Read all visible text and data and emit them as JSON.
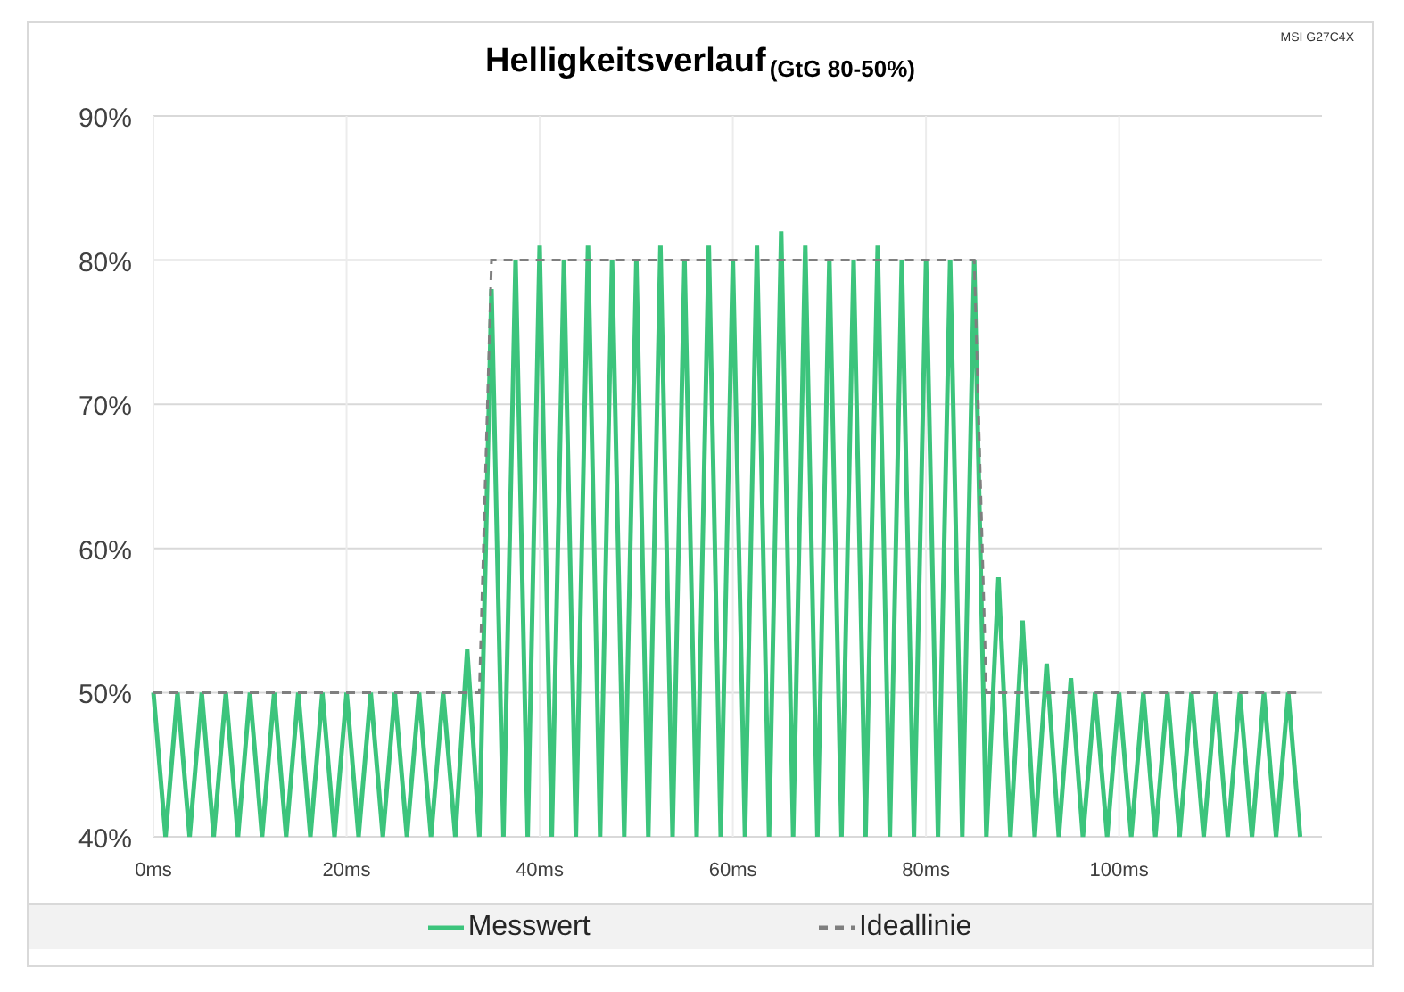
{
  "chart": {
    "subtitle": "(GtG 80-50%)",
    "corner_label": "MSI G27C4X",
    "chart_data": {
      "type": "line",
      "title": "Helligkeitsverlauf",
      "x": [
        0,
        1.25,
        2.5,
        3.75,
        5,
        6.25,
        7.5,
        8.75,
        10,
        11.25,
        12.5,
        13.75,
        15,
        16.25,
        17.5,
        18.75,
        20,
        21.25,
        22.5,
        23.75,
        25,
        26.25,
        27.5,
        28.75,
        30,
        31.25,
        32.5,
        33.75,
        35,
        36.25,
        37.5,
        38.75,
        40,
        41.25,
        42.5,
        43.75,
        45,
        46.25,
        47.5,
        48.75,
        50,
        51.25,
        52.5,
        53.75,
        55,
        56.25,
        57.5,
        58.75,
        60,
        61.25,
        62.5,
        63.75,
        65,
        66.25,
        67.5,
        68.75,
        70,
        71.25,
        72.5,
        73.75,
        75,
        76.25,
        77.5,
        78.75,
        80,
        81.25,
        82.5,
        83.75,
        85,
        86.25,
        87.5,
        88.75,
        90,
        91.25,
        92.5,
        93.75,
        95,
        96.25,
        97.5,
        98.75,
        100,
        101.25,
        102.5,
        103.75,
        105,
        106.25,
        107.5,
        108.75,
        110,
        111.25,
        112.5,
        113.75,
        115,
        116.25,
        117.5,
        118.75
      ],
      "series": [
        {
          "name": "Messwert",
          "color": "#3cc47c",
          "line_style": "solid",
          "values": [
            50,
            40,
            50,
            40,
            50,
            40,
            50,
            40,
            50,
            40,
            50,
            40,
            50,
            40,
            50,
            40,
            50,
            40,
            50,
            40,
            50,
            40,
            50,
            40,
            50,
            40,
            53,
            40,
            78,
            40,
            80,
            40,
            81,
            40,
            80,
            40,
            81,
            40,
            80,
            40,
            80,
            40,
            81,
            40,
            80,
            40,
            81,
            40,
            80,
            40,
            81,
            40,
            82,
            40,
            81,
            40,
            80,
            40,
            80,
            40,
            81,
            40,
            80,
            40,
            80,
            40,
            80,
            40,
            80,
            40,
            58,
            40,
            55,
            40,
            52,
            40,
            51,
            40,
            50,
            40,
            50,
            40,
            50,
            40,
            50,
            40,
            50,
            40,
            50,
            40,
            50,
            40,
            50,
            40,
            50,
            40
          ]
        },
        {
          "name": "Ideallinie",
          "color": "#7f7f7f",
          "line_style": "dashed",
          "values": [
            50,
            50,
            50,
            50,
            50,
            50,
            50,
            50,
            50,
            50,
            50,
            50,
            50,
            50,
            50,
            50,
            50,
            50,
            50,
            50,
            50,
            50,
            50,
            50,
            50,
            50,
            50,
            50,
            80,
            80,
            80,
            80,
            80,
            80,
            80,
            80,
            80,
            80,
            80,
            80,
            80,
            80,
            80,
            80,
            80,
            80,
            80,
            80,
            80,
            80,
            80,
            80,
            80,
            80,
            80,
            80,
            80,
            80,
            80,
            80,
            80,
            80,
            80,
            80,
            80,
            80,
            80,
            80,
            80,
            50,
            50,
            50,
            50,
            50,
            50,
            50,
            50,
            50,
            50,
            50,
            50,
            50,
            50,
            50,
            50,
            50,
            50,
            50,
            50,
            50,
            50,
            50,
            50,
            50,
            50,
            50
          ]
        }
      ],
      "grid": true,
      "xlim": [
        0,
        121
      ],
      "ylim": [
        40,
        90
      ],
      "xticks": [
        {
          "value": 0,
          "label": "0ms"
        },
        {
          "value": 20,
          "label": "20ms"
        },
        {
          "value": 40,
          "label": "40ms"
        },
        {
          "value": 60,
          "label": "60ms"
        },
        {
          "value": 80,
          "label": "80ms"
        },
        {
          "value": 100,
          "label": "100ms"
        }
      ],
      "yticks": [
        {
          "value": 40,
          "label": "40%"
        },
        {
          "value": 50,
          "label": "50%"
        },
        {
          "value": 60,
          "label": "60%"
        },
        {
          "value": 70,
          "label": "70%"
        },
        {
          "value": 80,
          "label": "80%"
        },
        {
          "value": 90,
          "label": "90%"
        }
      ]
    }
  }
}
